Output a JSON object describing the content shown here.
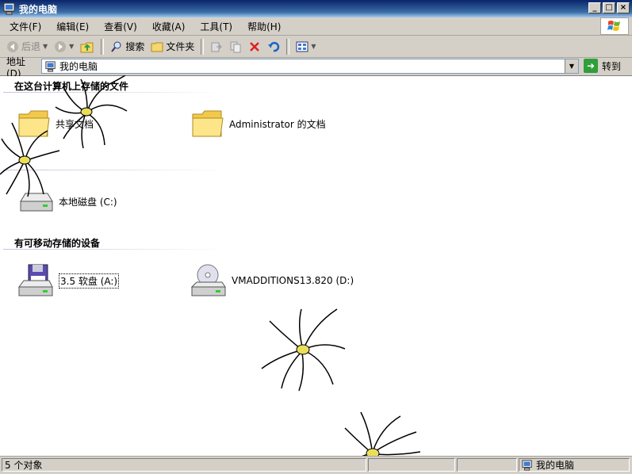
{
  "window": {
    "title": "我的电脑"
  },
  "menu": [
    "文件(F)",
    "编辑(E)",
    "查看(V)",
    "收藏(A)",
    "工具(T)",
    "帮助(H)"
  ],
  "toolbar": {
    "back": "后退",
    "search": "搜索",
    "folders": "文件夹"
  },
  "address": {
    "label": "地址(D)",
    "value": "我的电脑",
    "go": "转到"
  },
  "groups": {
    "stored": "在这台计算机上存储的文件",
    "removable": "有可移动存储的设备"
  },
  "items": {
    "shared": "共享文档",
    "admin": "Administrator 的文档",
    "c_drive": "本地磁盘 (C:)",
    "a_drive": "3.5 软盘 (A:)",
    "d_drive": "VMADDITIONS13.820 (D:)"
  },
  "status": {
    "count": "5 个对象",
    "location": "我的电脑"
  },
  "icons": [
    "my-computer-icon",
    "windows-logo-icon",
    "back-icon",
    "forward-icon",
    "up-folder-icon",
    "search-icon",
    "folders-icon",
    "move-to-icon",
    "copy-to-icon",
    "delete-icon",
    "undo-icon",
    "views-icon",
    "folder-icon",
    "hard-disk-icon",
    "floppy-icon",
    "cd-drive-icon",
    "go-icon"
  ]
}
